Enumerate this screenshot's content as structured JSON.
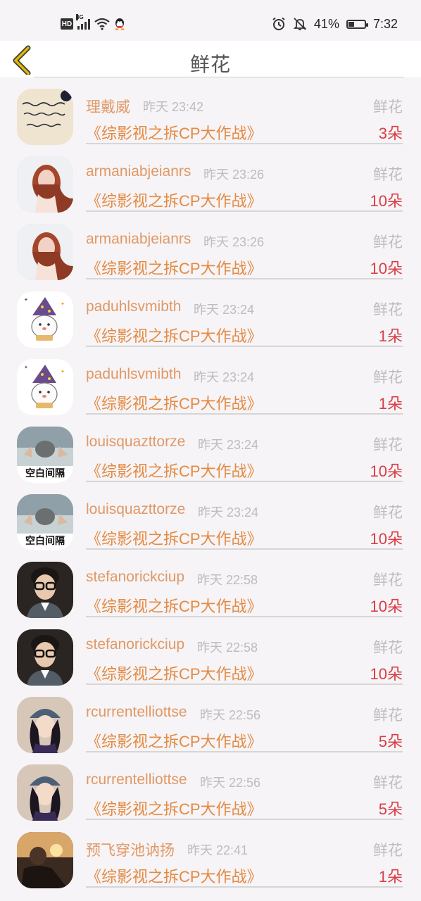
{
  "status_bar": {
    "hd": "HD",
    "network": "4G",
    "battery_percent": "41%",
    "battery_level": 0.41,
    "time": "7:32",
    "icons": [
      "hd-icon",
      "signal-icon",
      "wifi-icon",
      "qq-icon",
      "alarm-icon",
      "mute-icon",
      "battery-icon"
    ]
  },
  "nav": {
    "title": "鲜花",
    "back_icon": "chevron-left-icon",
    "accent_color": "#e0b900"
  },
  "colors": {
    "username": "#e19866",
    "program": "#e48a43",
    "quantity": "#d93e46",
    "muted": "#bdbdbd"
  },
  "records": [
    {
      "user": "理戴威",
      "time": "昨天 23:42",
      "gift": "鲜花",
      "program": "《综影视之拆CP大作战》",
      "qty": "3朵",
      "avatar": "handwriting-note-avatar"
    },
    {
      "user": "armaniabjeianrs",
      "time": "昨天 23:26",
      "gift": "鲜花",
      "program": "《综影视之拆CP大作战》",
      "qty": "10朵",
      "avatar": "woman-photo-avatar"
    },
    {
      "user": "armaniabjeianrs",
      "time": "昨天 23:26",
      "gift": "鲜花",
      "program": "《综影视之拆CP大作战》",
      "qty": "10朵",
      "avatar": "woman-photo-avatar"
    },
    {
      "user": "paduhlsvmibth",
      "time": "昨天 23:24",
      "gift": "鲜花",
      "program": "《综影视之拆CP大作战》",
      "qty": "1朵",
      "avatar": "cartoon-wizard-avatar"
    },
    {
      "user": "paduhlsvmibth",
      "time": "昨天 23:24",
      "gift": "鲜花",
      "program": "《综影视之拆CP大作战》",
      "qty": "1朵",
      "avatar": "cartoon-wizard-avatar"
    },
    {
      "user": "louisquazttorze",
      "time": "昨天 23:24",
      "gift": "鲜花",
      "program": "《综影视之拆CP大作战》",
      "qty": "10朵",
      "avatar": "blank-space-avatar",
      "avatar_text": "空白间隔"
    },
    {
      "user": "louisquazttorze",
      "time": "昨天 23:24",
      "gift": "鲜花",
      "program": "《综影视之拆CP大作战》",
      "qty": "10朵",
      "avatar": "blank-space-avatar",
      "avatar_text": "空白间隔"
    },
    {
      "user": "stefanorickciup",
      "time": "昨天 22:58",
      "gift": "鲜花",
      "program": "《综影视之拆CP大作战》",
      "qty": "10朵",
      "avatar": "man-glasses-avatar"
    },
    {
      "user": "stefanorickciup",
      "time": "昨天 22:58",
      "gift": "鲜花",
      "program": "《综影视之拆CP大作战》",
      "qty": "10朵",
      "avatar": "man-glasses-avatar"
    },
    {
      "user": "rcurrentelliottse",
      "time": "昨天 22:56",
      "gift": "鲜花",
      "program": "《综影视之拆CP大作战》",
      "qty": "5朵",
      "avatar": "girl-beanie-avatar"
    },
    {
      "user": "rcurrentelliottse",
      "time": "昨天 22:56",
      "gift": "鲜花",
      "program": "《综影视之拆CP大作战》",
      "qty": "5朵",
      "avatar": "girl-beanie-avatar"
    },
    {
      "user": "预飞穿池讷扬",
      "time": "昨天 22:41",
      "gift": "鲜花",
      "program": "《综影视之拆CP大作战》",
      "qty": "1朵",
      "avatar": "sunset-car-avatar"
    }
  ]
}
